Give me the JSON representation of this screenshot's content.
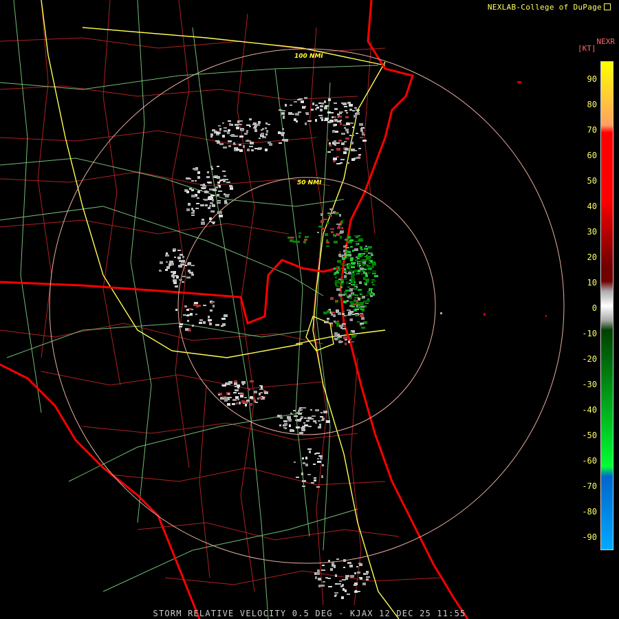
{
  "credit": "NEXLAB-College of DuPage",
  "product_code": "NEXR",
  "units": "[KT]",
  "caption": "STORM RELATIVE VELOCITY 0.5 DEG - KJAX 12 DEC 25 11:55",
  "rings": [
    {
      "label": "50 NMI"
    },
    {
      "label": "100 NMI"
    }
  ],
  "colorbar": {
    "ticks": [
      "90",
      "80",
      "70",
      "60",
      "50",
      "40",
      "30",
      "20",
      "10",
      "0",
      "-10",
      "-20",
      "-30",
      "-40",
      "-50",
      "-60",
      "-70",
      "-80",
      "-90"
    ],
    "colors": {
      "yellow": "#ffff00",
      "orange": "#ffa060",
      "red": "#ff0000",
      "dark_red": "#700000",
      "gray": "#aaaaaa",
      "dark_green": "#004000",
      "green": "#00ff33",
      "blue": "#0066cc",
      "cyan": "#00aaff"
    }
  },
  "map_colors": {
    "coastline": "#ff0000",
    "county": "#b02020",
    "highway": "#ffff55",
    "road": "#88dd88",
    "ring": "#e8b0a0"
  }
}
